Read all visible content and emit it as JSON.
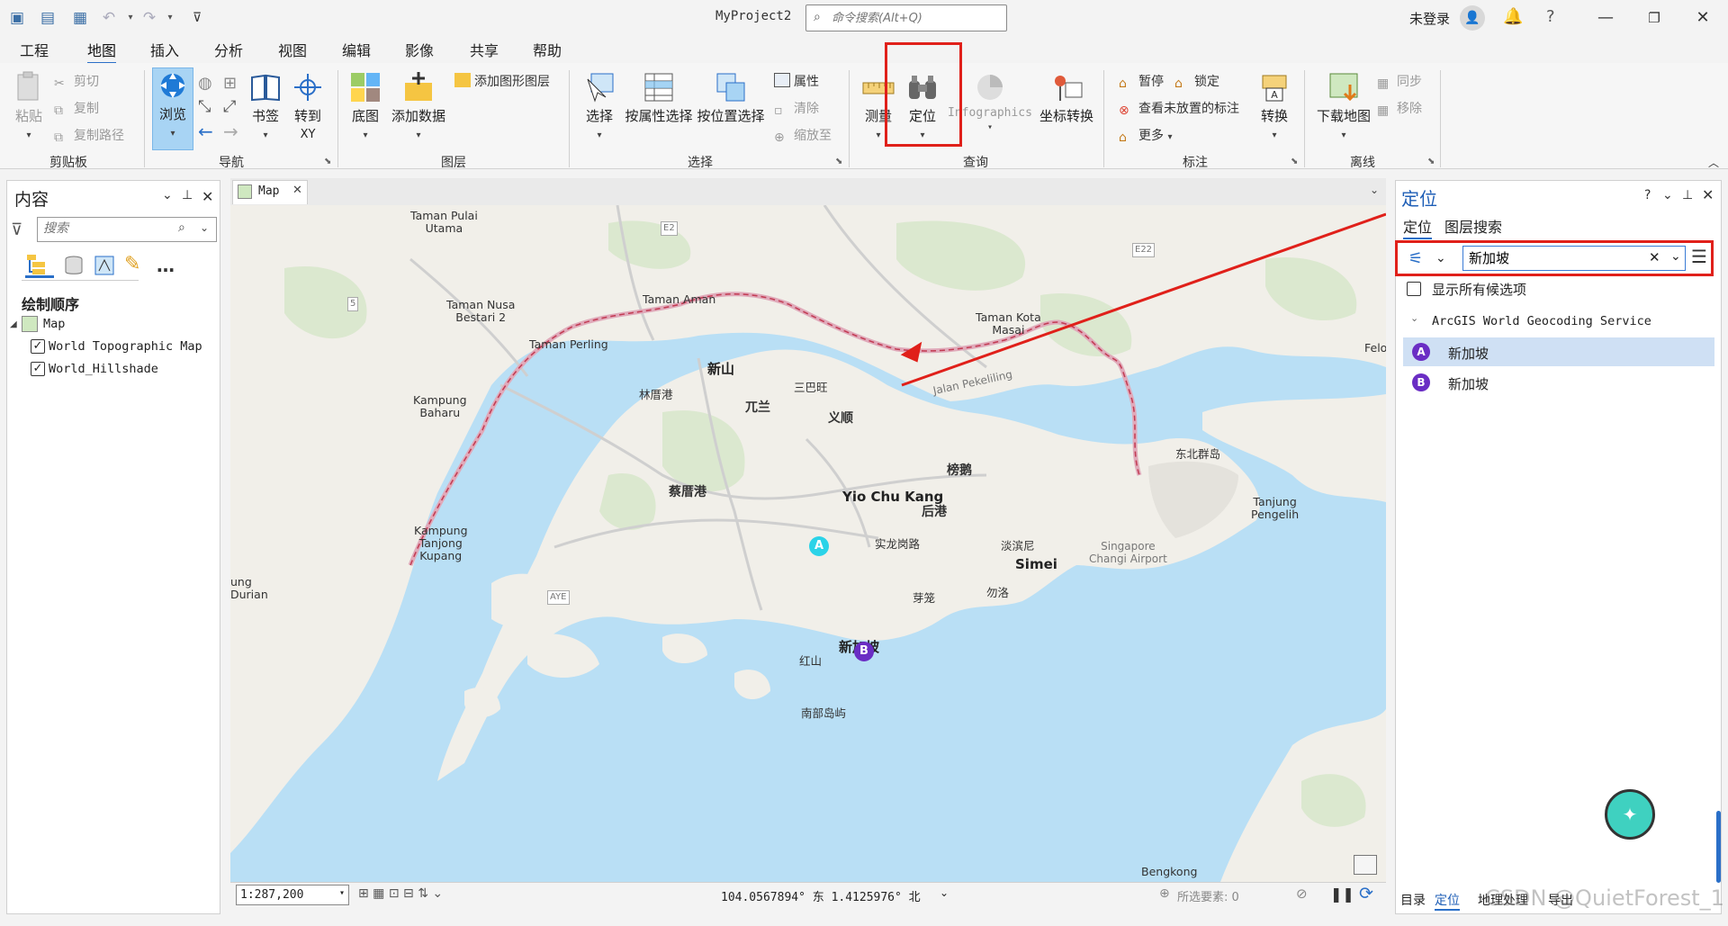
{
  "titlebar": {
    "project_title": "MyProject2",
    "command_search_placeholder": "命令搜索(Alt+Q)",
    "login_text": "未登录",
    "help_icon": "?"
  },
  "ribbon_tabs": [
    "工程",
    "地图",
    "插入",
    "分析",
    "视图",
    "编辑",
    "影像",
    "共享",
    "帮助"
  ],
  "active_tab": "地图",
  "clipboard": {
    "paste": "粘贴",
    "cut": "剪切",
    "copy": "复制",
    "copy_path": "复制路径",
    "label": "剪贴板"
  },
  "navigate": {
    "explore": "浏览",
    "bookmarks": "书签",
    "goto": "转到",
    "goto2": "XY",
    "label": "导航"
  },
  "layer": {
    "basemap": "底图",
    "add_data": "添加数据",
    "add_graphics": "添加图形图层",
    "label": "图层"
  },
  "selection": {
    "select": "选择",
    "by_attr": "按属性选择",
    "by_location": "按位置选择",
    "attributes": "属性",
    "clear": "清除",
    "zoom_to": "缩放至",
    "label": "选择"
  },
  "inquiry": {
    "measure": "测量",
    "locate": "定位",
    "infographics": "Infographics",
    "convert_coord": "坐标转换",
    "label": "查询"
  },
  "labeling": {
    "pause": "暂停",
    "lock": "锁定",
    "view_unplaced": "查看未放置的标注",
    "more": "更多",
    "convert": "转换",
    "label": "标注"
  },
  "offline": {
    "download_map": "下载地图",
    "sync": "同步",
    "remove": "移除",
    "label": "离线"
  },
  "contents_pane": {
    "title": "内容",
    "search_placeholder": "搜索",
    "drawing_order": "绘制顺序",
    "map_name": "Map",
    "layers": [
      "World Topographic Map",
      "World_Hillshade"
    ]
  },
  "map_view": {
    "tab_label": "Map",
    "labels": {
      "tp_utama": "Taman Pulai\nUtama",
      "e2": "E2",
      "e22": "E22",
      "route5": "5",
      "tn_bestari": "Taman Nusa\nBestari 2",
      "taman_aman": "Taman Aman",
      "taman_perling": "Taman Perling",
      "tk_masai": "Taman Kota\nMasai",
      "kampung_baharu": "Kampung\nBaharu",
      "xinshan": "新山",
      "sanbawang": "三巴旺",
      "linchugang": "林厝港",
      "wulan": "兀兰",
      "yishun": "义顺",
      "jalan_pekeliling": "Jalan Pekeliling",
      "dongbei": "东北群岛",
      "felo": "Felo",
      "bangehu": "榜鹅",
      "caicuogang": "蔡厝港",
      "yio_chu_kang": "Yio Chu Kang",
      "hougang": "后港",
      "tanjung_pengelih": "Tanjung\nPengelih",
      "kampung_tk": "Kampung\nTanjong\nKupang",
      "shilonggang": "实龙岗路",
      "danbinni": "淡滨尼",
      "changi": "Singapore\nChangi Airport",
      "simei": "Simei",
      "jung_durian": "ung\nDurian",
      "aye": "AYE",
      "yalong": "芽笼",
      "wuluo": "勿洛",
      "xinjiapo": "新加坡",
      "hongshan": "红山",
      "nanbu": "南部岛屿",
      "bengkong": "Bengkong",
      "pin_a": "A",
      "pin_b": "B"
    }
  },
  "statusbar": {
    "scale": "1:287,200",
    "coordinates": "104.0567894° 东 1.4125976° 北",
    "selected_features": "所选要素: 0"
  },
  "locate_pane": {
    "title": "定位",
    "tabs": [
      "定位",
      "图层搜索"
    ],
    "search_value": "新加坡",
    "show_all_candidates": "显示所有候选项",
    "provider": "ArcGIS World Geocoding Service",
    "results": [
      {
        "pin": "A",
        "label": "新加坡"
      },
      {
        "pin": "B",
        "label": "新加坡"
      }
    ],
    "bottom_tabs": [
      "目录",
      "定位",
      "地理处理",
      "导出"
    ],
    "watermark": "CSDN @QuietForest_1"
  },
  "colors": {
    "accent": "#2a6fc8",
    "highlight_red": "#e0201a",
    "water": "#b9dff5",
    "land": "#f1efe9",
    "pin_a": "#2bd3e8",
    "pin_b": "#6a2dc4"
  }
}
